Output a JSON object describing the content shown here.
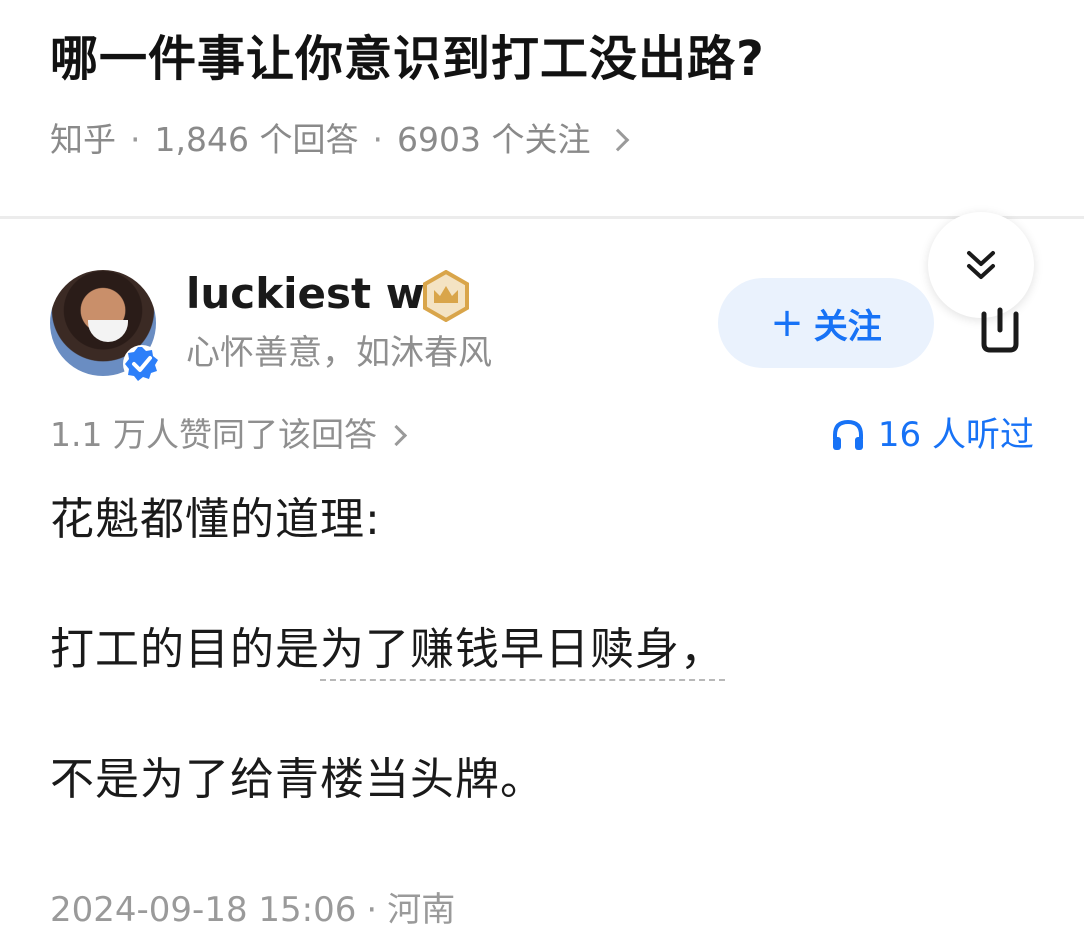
{
  "question": {
    "title": "哪一件事让你意识到打工没出路?",
    "source": "知乎",
    "separator": "·",
    "answers": "1,846 个回答",
    "followers": "6903 个关注"
  },
  "expand_icon": "double-chevron-down-icon",
  "author": {
    "name": "luckiest w",
    "bio": "心怀善意，如沐春风",
    "avatar_icon": "avatar",
    "verified_icon": "verified-check-icon",
    "badge_icon": "crown-badge-icon"
  },
  "follow_button": {
    "plus": "+",
    "label": "关注"
  },
  "share_icon": "share-icon",
  "answer": {
    "votes": "1.1 万人赞同了该回答",
    "listens": "16 人听过",
    "listen_icon": "headphones-icon",
    "paragraphs": {
      "p1": "花魁都懂的道理:",
      "p2_a": "打工的目的是",
      "p2_b": "为了赚钱早日赎身，",
      "p3": "不是为了给青楼当头牌。"
    },
    "date": "2024-09-18 15:06",
    "dot": "·",
    "location": "河南"
  },
  "colors": {
    "accent": "#1772f6",
    "follow_bg": "#eaf2fd",
    "meta_gray": "#8f8f8f",
    "crown_gold": "#d9a54a"
  }
}
